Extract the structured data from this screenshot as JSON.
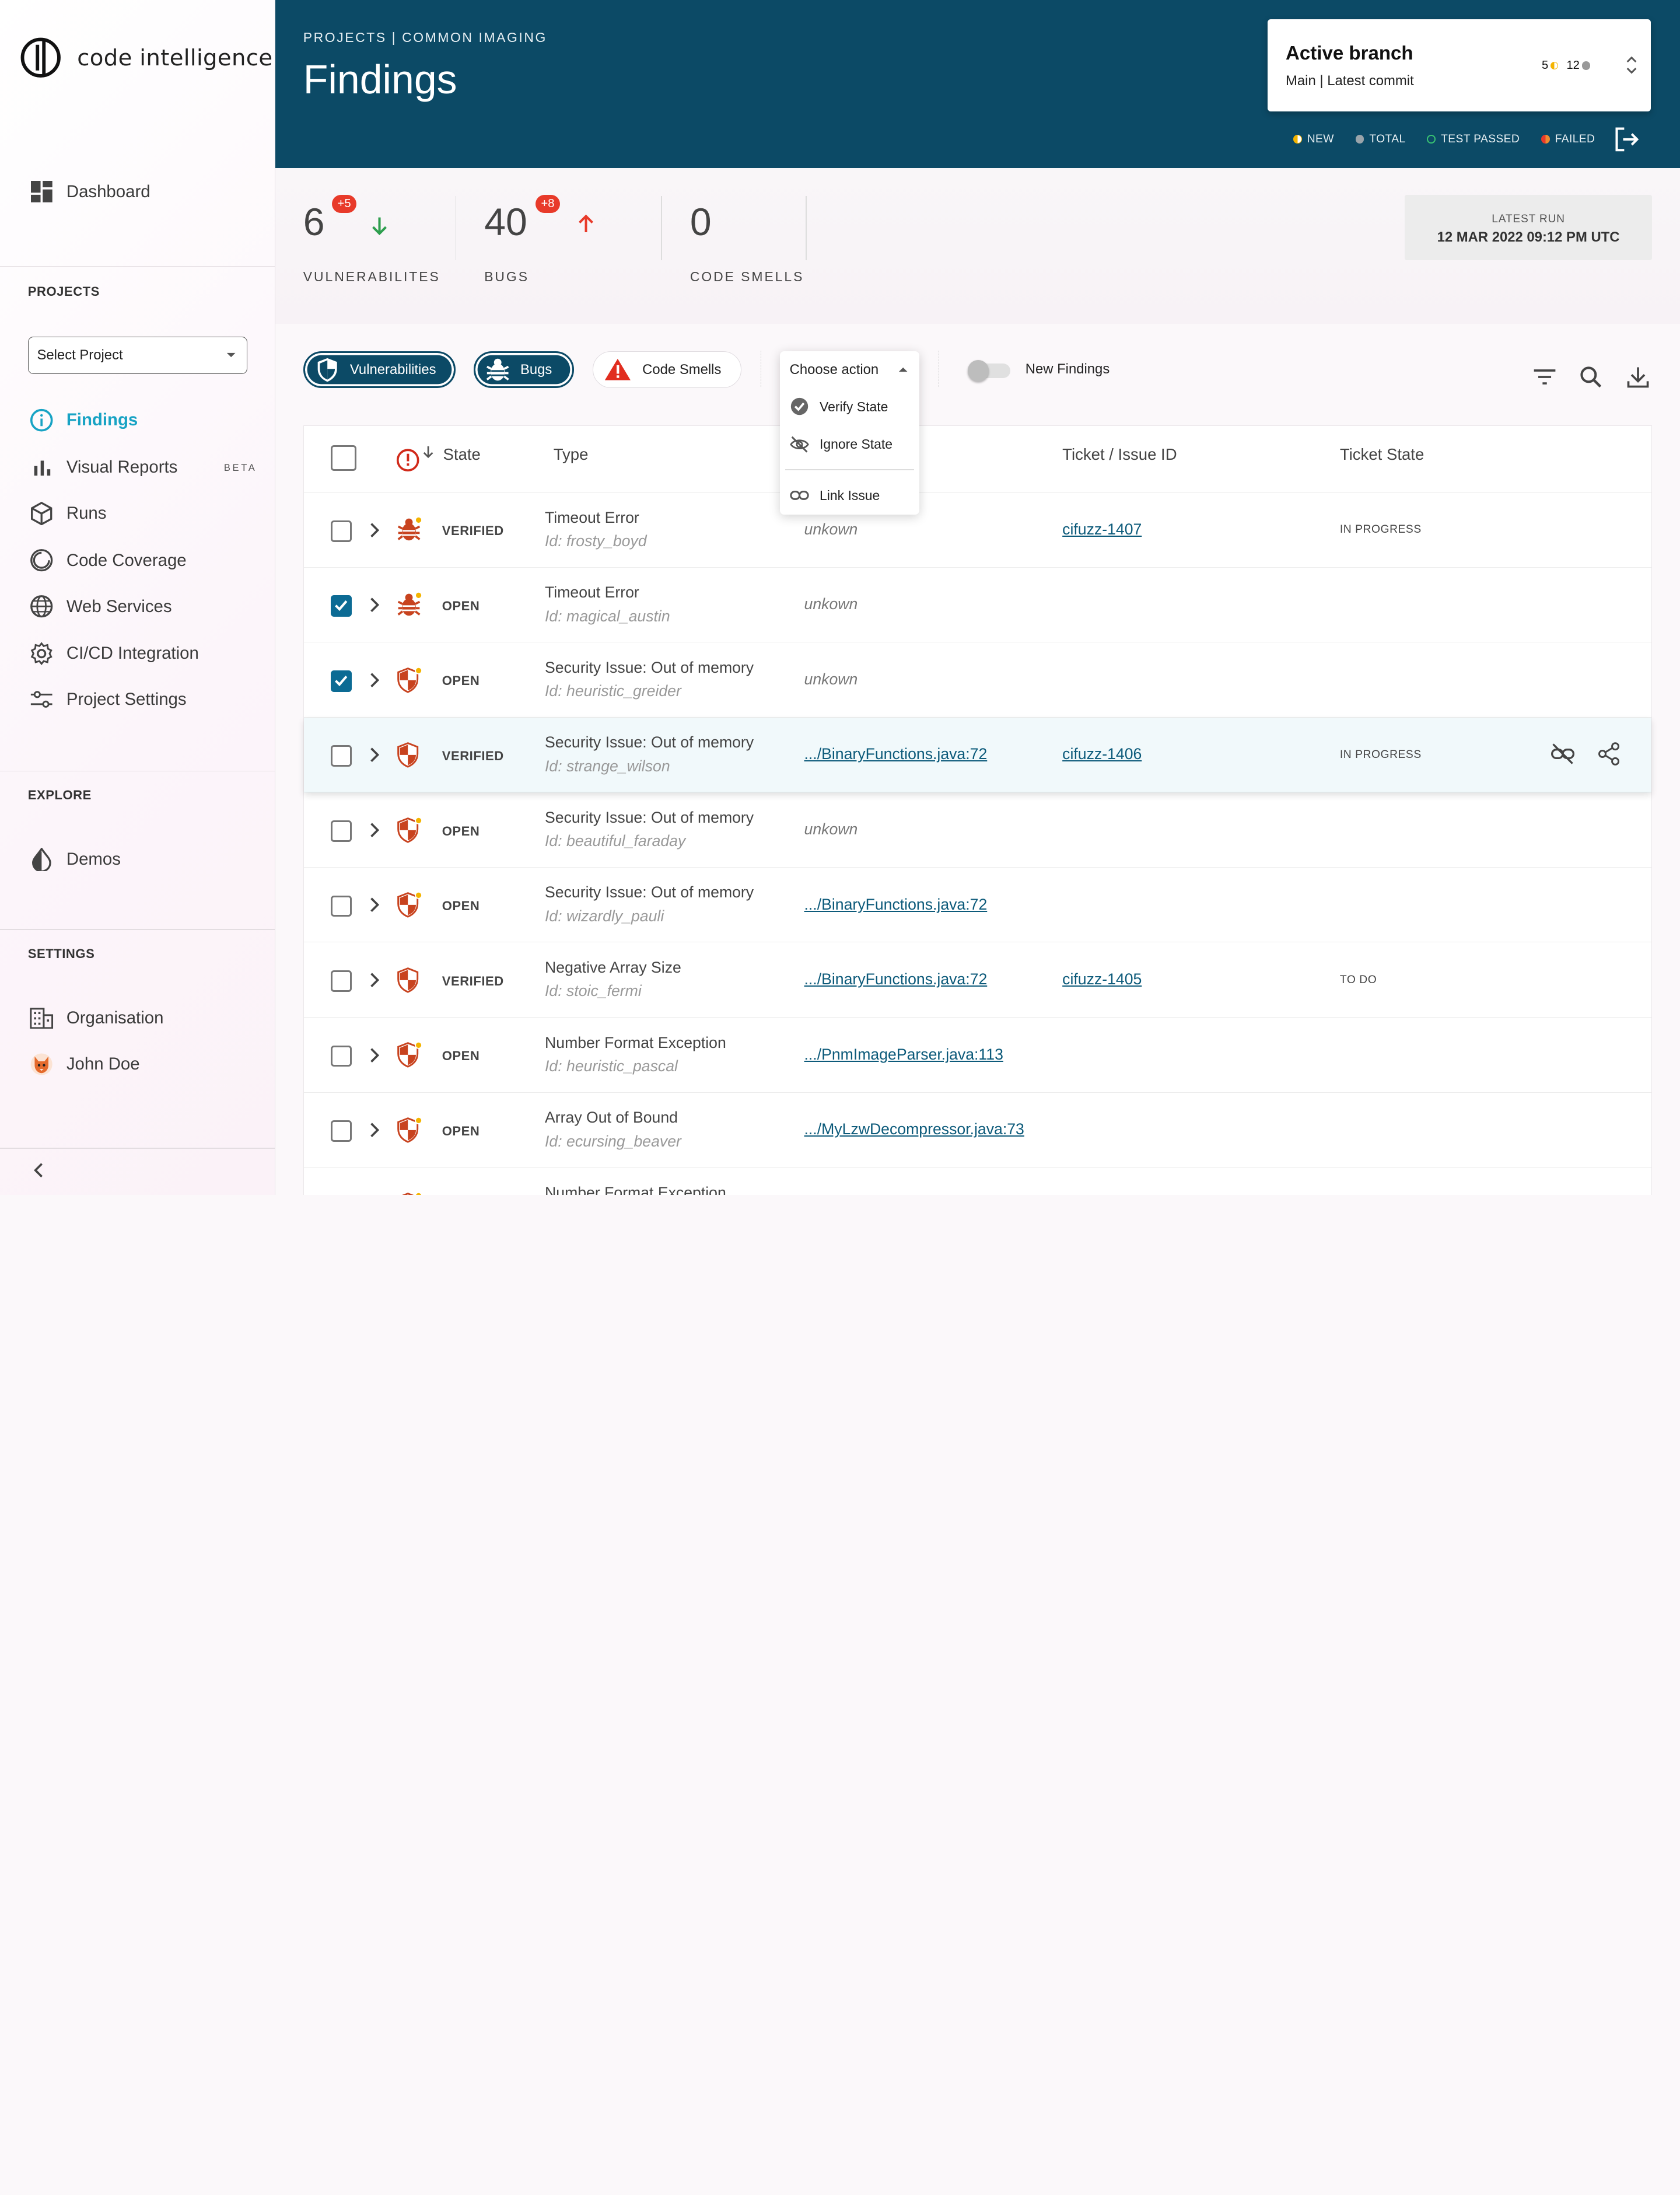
{
  "app": {
    "logo_text": "code intelligence"
  },
  "sidebar": {
    "dashboard": "Dashboard",
    "projects_label": "PROJECTS",
    "select_project": "Select Project",
    "items": [
      {
        "label": "Findings",
        "icon": "info-icon",
        "active": true
      },
      {
        "label": "Visual Reports",
        "icon": "bar-chart-icon",
        "badge": "BETA"
      },
      {
        "label": "Runs",
        "icon": "cube-icon"
      },
      {
        "label": "Code Coverage",
        "icon": "coverage-icon"
      },
      {
        "label": "Web Services",
        "icon": "globe-icon"
      },
      {
        "label": "CI/CD Integration",
        "icon": "gear-icon"
      },
      {
        "label": "Project Settings",
        "icon": "sliders-icon"
      }
    ],
    "explore_label": "EXPLORE",
    "demos": "Demos",
    "settings_label": "SETTINGS",
    "organisation": "Organisation",
    "user": "John Doe"
  },
  "header": {
    "breadcrumb": "PROJECTS |  COMMON IMAGING",
    "title": "Findings",
    "branch": {
      "title": "Active branch",
      "subtitle": "Main | Latest commit",
      "new_count": "5",
      "total_count": "12"
    },
    "legend": {
      "new": "NEW",
      "total": "TOTAL",
      "passed": "TEST PASSED",
      "failed": "FAILED"
    }
  },
  "stats": {
    "vulnerabilities": {
      "value": "6",
      "delta": "+5",
      "label": "VULNERABILITES"
    },
    "bugs": {
      "value": "40",
      "delta": "+8",
      "label": "BUGS"
    },
    "code_smells": {
      "value": "0",
      "label": "CODE SMELLS"
    },
    "latest_run_label": "LATEST RUN",
    "latest_run_value": "12 MAR 2022 09:12 PM UTC"
  },
  "filters": {
    "vulnerabilities": "Vulnerabilities",
    "bugs": "Bugs",
    "code_smells": "Code Smells",
    "new_findings": "New Findings"
  },
  "action_menu": {
    "label": "Choose action",
    "verify": "Verify State",
    "ignore": "Ignore State",
    "link": "Link Issue"
  },
  "table": {
    "headers": {
      "state": "State",
      "type": "Type",
      "ticket": "Ticket / Issue ID",
      "ticket_state": "Ticket State"
    },
    "rows": [
      {
        "kind": "bug",
        "checked": false,
        "state": "VERIFIED",
        "type": "Timeout Error",
        "id": "Id: frosty_boyd",
        "location": "unkown",
        "loc_link": false,
        "ticket": "cifuzz-1407",
        "ticket_state": "IN PROGRESS"
      },
      {
        "kind": "bug",
        "checked": true,
        "state": "OPEN",
        "type": "Timeout Error",
        "id": "Id: magical_austin",
        "location": "unkown",
        "loc_link": false,
        "ticket": "",
        "ticket_state": ""
      },
      {
        "kind": "vuln-new",
        "checked": true,
        "state": "OPEN",
        "type": "Security Issue: Out of memory",
        "id": "Id: heuristic_greider",
        "location": "unkown",
        "loc_link": false,
        "ticket": "",
        "ticket_state": ""
      },
      {
        "kind": "vuln",
        "checked": false,
        "state": "VERIFIED",
        "type": "Security Issue: Out of memory",
        "id": "Id: strange_wilson",
        "location": ".../BinaryFunctions.java:72",
        "loc_link": true,
        "ticket": "cifuzz-1406",
        "ticket_state": "IN PROGRESS",
        "highlight": true
      },
      {
        "kind": "vuln-new",
        "checked": false,
        "state": "OPEN",
        "type": "Security Issue: Out of memory",
        "id": "Id: beautiful_faraday",
        "location": "unkown",
        "loc_link": false,
        "ticket": "",
        "ticket_state": ""
      },
      {
        "kind": "vuln-new",
        "checked": false,
        "state": "OPEN",
        "type": "Security Issue: Out of memory",
        "id": "Id: wizardly_pauli",
        "location": ".../BinaryFunctions.java:72",
        "loc_link": true,
        "ticket": "",
        "ticket_state": ""
      },
      {
        "kind": "vuln",
        "checked": false,
        "state": "VERIFIED",
        "type": "Negative Array Size",
        "id": "Id: stoic_fermi",
        "location": ".../BinaryFunctions.java:72",
        "loc_link": true,
        "ticket": "cifuzz-1405",
        "ticket_state": "TO DO"
      },
      {
        "kind": "vuln-new",
        "checked": false,
        "state": "OPEN",
        "type": "Number Format Exception",
        "id": "Id: heuristic_pascal",
        "location": ".../PnmImageParser.java:113",
        "loc_link": true,
        "ticket": "",
        "ticket_state": ""
      },
      {
        "kind": "vuln-new",
        "checked": false,
        "state": "OPEN",
        "type": "Array Out of Bound",
        "id": "Id: ecursing_beaver",
        "location": ".../MyLzwDecompressor.java:73",
        "loc_link": true,
        "ticket": "",
        "ticket_state": ""
      },
      {
        "kind": "vuln-new",
        "checked": false,
        "state": "",
        "type": "Number Format Exception",
        "id": "",
        "location": "",
        "loc_link": false,
        "ticket": "",
        "ticket_state": ""
      }
    ]
  },
  "colors": {
    "primary": "#0c4a66",
    "accent": "#18a3c4",
    "danger": "#e83a2a",
    "vuln": "#c8431f",
    "new": "#f4b400"
  }
}
